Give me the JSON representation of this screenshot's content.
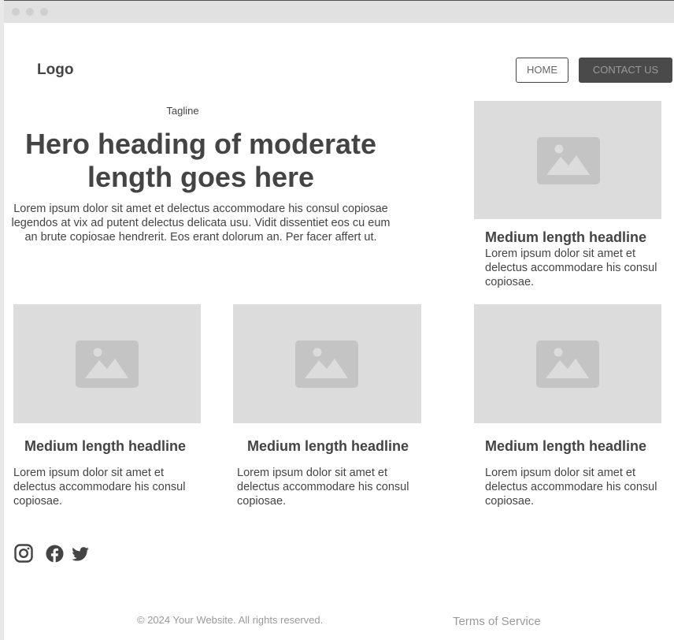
{
  "header": {
    "logo": "Logo",
    "nav": {
      "home_label": "HOME",
      "contact_label": "CONTACT US"
    }
  },
  "hero": {
    "tagline": "Tagline",
    "heading": "Hero heading of moderate length goes here",
    "body": "Lorem ipsum dolor sit amet et delectus accommodare his consul copiosae legendos at vix ad putent delectus delicata usu. Vidit dissentiet eos cu eum an brute copiosae hendrerit. Eos erant dolorum an. Per facer affert ut."
  },
  "feature_card": {
    "image_icon": "image-placeholder-icon",
    "headline": "Medium length headline",
    "body": "Lorem ipsum dolor sit amet et delectus accommodare his consul copiosae."
  },
  "cards": [
    {
      "image_icon": "image-placeholder-icon",
      "headline": "Medium length headline",
      "body": "Lorem ipsum dolor sit amet et delectus accommodare his consul copiosae."
    },
    {
      "image_icon": "image-placeholder-icon",
      "headline": "Medium length headline",
      "body": "Lorem ipsum dolor sit amet et delectus accommodare his consul copiosae."
    },
    {
      "image_icon": "image-placeholder-icon",
      "headline": "Medium length headline",
      "body": "Lorem ipsum dolor sit amet et delectus accommodare his consul copiosae."
    }
  ],
  "social": {
    "icons": [
      "instagram-icon",
      "facebook-icon",
      "twitter-icon"
    ]
  },
  "footer": {
    "copyright": "© 2024 Your Website. All rights reserved.",
    "terms": "Terms of Service"
  },
  "colors": {
    "text": "#444444",
    "placeholder": "#dcdcdc",
    "placeholder_icon": "#c4c4c4",
    "button_dark": "#4a4a4a",
    "muted": "#9a9a9a"
  }
}
